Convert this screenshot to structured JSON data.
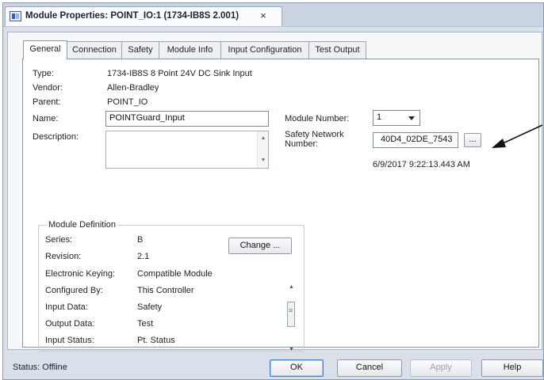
{
  "window": {
    "tab_title": "Module Properties: POINT_IO:1 (1734-IB8S 2.001)",
    "tab_close": "×",
    "app_icon": "module-properties-icon"
  },
  "tabs": [
    {
      "label": "General",
      "active": true
    },
    {
      "label": "Connection",
      "active": false
    },
    {
      "label": "Safety",
      "active": false
    },
    {
      "label": "Module Info",
      "active": false
    },
    {
      "label": "Input Configuration",
      "active": false
    },
    {
      "label": "Test Output",
      "active": false
    }
  ],
  "general": {
    "type_label": "Type:",
    "type_value": "1734-IB8S 8 Point 24V DC Sink Input",
    "vendor_label": "Vendor:",
    "vendor_value": "Allen-Bradley",
    "parent_label": "Parent:",
    "parent_value": "POINT_IO",
    "name_label": "Name:",
    "name_value": "POINTGuard_Input",
    "description_label": "Description:",
    "description_value": "",
    "module_number_label": "Module Number:",
    "module_number_value": "1",
    "safety_network_label_1": "Safety Network",
    "safety_network_label_2": "Number:",
    "safety_network_value": "40D4_02DE_7543",
    "safety_network_button": "...",
    "safety_network_timestamp": "6/9/2017 9:22:13.443 AM"
  },
  "module_definition": {
    "title": "Module Definition",
    "series_label": "Series:",
    "series_value": "B",
    "revision_label": "Revision:",
    "revision_value": "2.1",
    "keying_label": "Electronic Keying:",
    "keying_value": "Compatible Module",
    "change_button": "Change ...",
    "rows": [
      {
        "label": "Configured By:",
        "value": "This Controller"
      },
      {
        "label": "Input Data:",
        "value": "Safety"
      },
      {
        "label": "Output Data:",
        "value": "Test"
      },
      {
        "label": "Input Status:",
        "value": "Pt. Status"
      }
    ]
  },
  "footer": {
    "status": "Status:  Offline",
    "ok": "OK",
    "cancel": "Cancel",
    "apply": "Apply",
    "help": "Help"
  },
  "colors": {
    "window_bg": "#d9e0ea",
    "panel_bg": "#f7f8fa",
    "ok_border": "#4a7fc6"
  }
}
